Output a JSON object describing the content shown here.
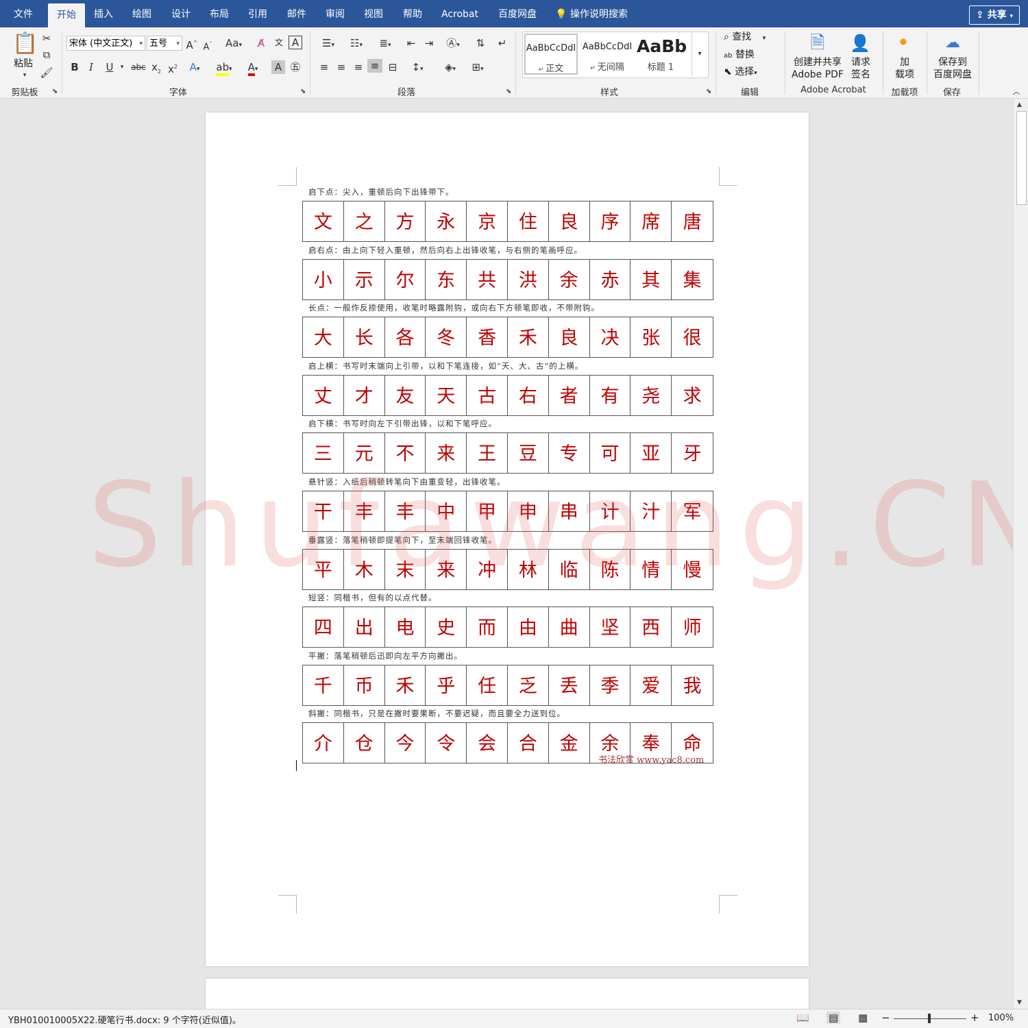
{
  "tabs": [
    "文件",
    "开始",
    "插入",
    "绘图",
    "设计",
    "布局",
    "引用",
    "邮件",
    "审阅",
    "视图",
    "帮助",
    "Acrobat",
    "百度网盘"
  ],
  "active_tab": "开始",
  "search_label": "操作说明搜索",
  "share_label": "共享",
  "ribbon": {
    "clipboard": {
      "paste_label": "粘贴",
      "group_label": "剪贴板"
    },
    "font": {
      "font_name": "宋体 (中文正文)",
      "font_size": "五号",
      "case_label": "Aa",
      "group_label": "字体"
    },
    "paragraph": {
      "group_label": "段落"
    },
    "styles": {
      "items": [
        {
          "sample": "AaBbCcDdI",
          "name": "正文"
        },
        {
          "sample": "AaBbCcDdI",
          "name": "无间隔"
        },
        {
          "sample": "AaBb",
          "name": "标题 1"
        }
      ],
      "group_label": "样式"
    },
    "editing": {
      "find_label": "查找",
      "replace_label": "替换",
      "select_label": "选择",
      "group_label": "编辑"
    },
    "acrobat": {
      "create_share_label_1": "创建并共享",
      "create_share_label_2": "Adobe PDF",
      "request_sign_label_1": "请求",
      "request_sign_label_2": "签名",
      "group_label": "Adobe Acrobat"
    },
    "addins": {
      "button_label_1": "加",
      "button_label_2": "载项",
      "group_label": "加载项"
    },
    "save": {
      "button_label_1": "保存到",
      "button_label_2": "百度网盘",
      "group_label": "保存"
    }
  },
  "document": {
    "sections": [
      {
        "rule": "启下点：尖入，重顿后向下出锋带下。",
        "chars": [
          "文",
          "之",
          "方",
          "永",
          "京",
          "住",
          "良",
          "序",
          "席",
          "唐"
        ]
      },
      {
        "rule": "启右点：由上向下轻入重顿，然后向右上出锋收笔，与右侧的笔画呼应。",
        "chars": [
          "小",
          "示",
          "尔",
          "东",
          "共",
          "洪",
          "余",
          "赤",
          "其",
          "集"
        ]
      },
      {
        "rule": "长点：一般作反捺使用，收笔时略露附钩，或向右下方顿笔即收，不带附钩。",
        "chars": [
          "大",
          "长",
          "各",
          "冬",
          "香",
          "禾",
          "良",
          "决",
          "张",
          "很"
        ]
      },
      {
        "rule": "启上横：书写时末端向上引带，以和下笔连接，如“天、大、古”的上横。",
        "chars": [
          "丈",
          "才",
          "友",
          "天",
          "古",
          "右",
          "者",
          "有",
          "尧",
          "求"
        ]
      },
      {
        "rule": "启下横：书写时向左下引带出锋，以和下笔呼应。",
        "chars": [
          "三",
          "元",
          "不",
          "来",
          "王",
          "豆",
          "专",
          "可",
          "亚",
          "牙"
        ]
      },
      {
        "rule": "悬针竖：入纸后稍顿转笔向下由重变轻，出锋收笔。",
        "chars": [
          "干",
          "丰",
          "丰",
          "中",
          "甲",
          "申",
          "串",
          "计",
          "汁",
          "军"
        ]
      },
      {
        "rule": "垂露竖：落笔稍顿即提笔向下，至末端回锋收笔。",
        "chars": [
          "平",
          "木",
          "末",
          "来",
          "冲",
          "林",
          "临",
          "陈",
          "情",
          "慢"
        ]
      },
      {
        "rule": "短竖：同楷书，但有的以点代替。",
        "chars": [
          "四",
          "出",
          "电",
          "史",
          "而",
          "由",
          "曲",
          "坚",
          "西",
          "师"
        ]
      },
      {
        "rule": "平撇：落笔稍顿后迅即向左平方向撇出。",
        "chars": [
          "千",
          "币",
          "禾",
          "乎",
          "任",
          "乏",
          "丢",
          "季",
          "爱",
          "我"
        ]
      },
      {
        "rule": "斜撇：同楷书，只是在撇时要果断，不要迟疑，而且要全力送到位。",
        "chars": [
          "介",
          "仓",
          "今",
          "令",
          "会",
          "合",
          "金",
          "余",
          "奉",
          "命"
        ]
      }
    ],
    "source_note": "书法欣赏 www.yac8.com",
    "watermark": "Shufawang.CN"
  },
  "status": {
    "doc_info": "YBH010010005X22.硬笔行书.docx: 9 个字符(近似值)。",
    "zoom": "100%"
  }
}
